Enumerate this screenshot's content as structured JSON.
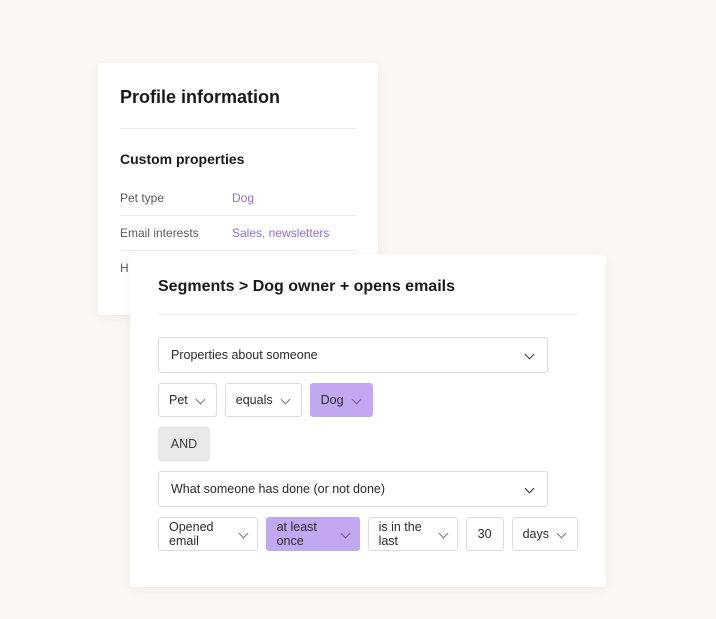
{
  "profile": {
    "title": "Profile information",
    "subtitle": "Custom properties",
    "rows": [
      {
        "label": "Pet type",
        "value": "Dog"
      },
      {
        "label": "Email interests",
        "value": "Sales, newsletters"
      },
      {
        "label": "H",
        "value": ""
      }
    ]
  },
  "segments": {
    "title": "Segments > Dog owner + opens emails",
    "condition1": {
      "group": "Properties about someone",
      "field": "Pet",
      "operator": "equals",
      "value": "Dog"
    },
    "join": "AND",
    "condition2": {
      "group": "What someone has done (or not done)",
      "event": "Opened email",
      "frequency": "at least once",
      "timing": "is in the last",
      "count": "30",
      "unit": "days"
    }
  }
}
